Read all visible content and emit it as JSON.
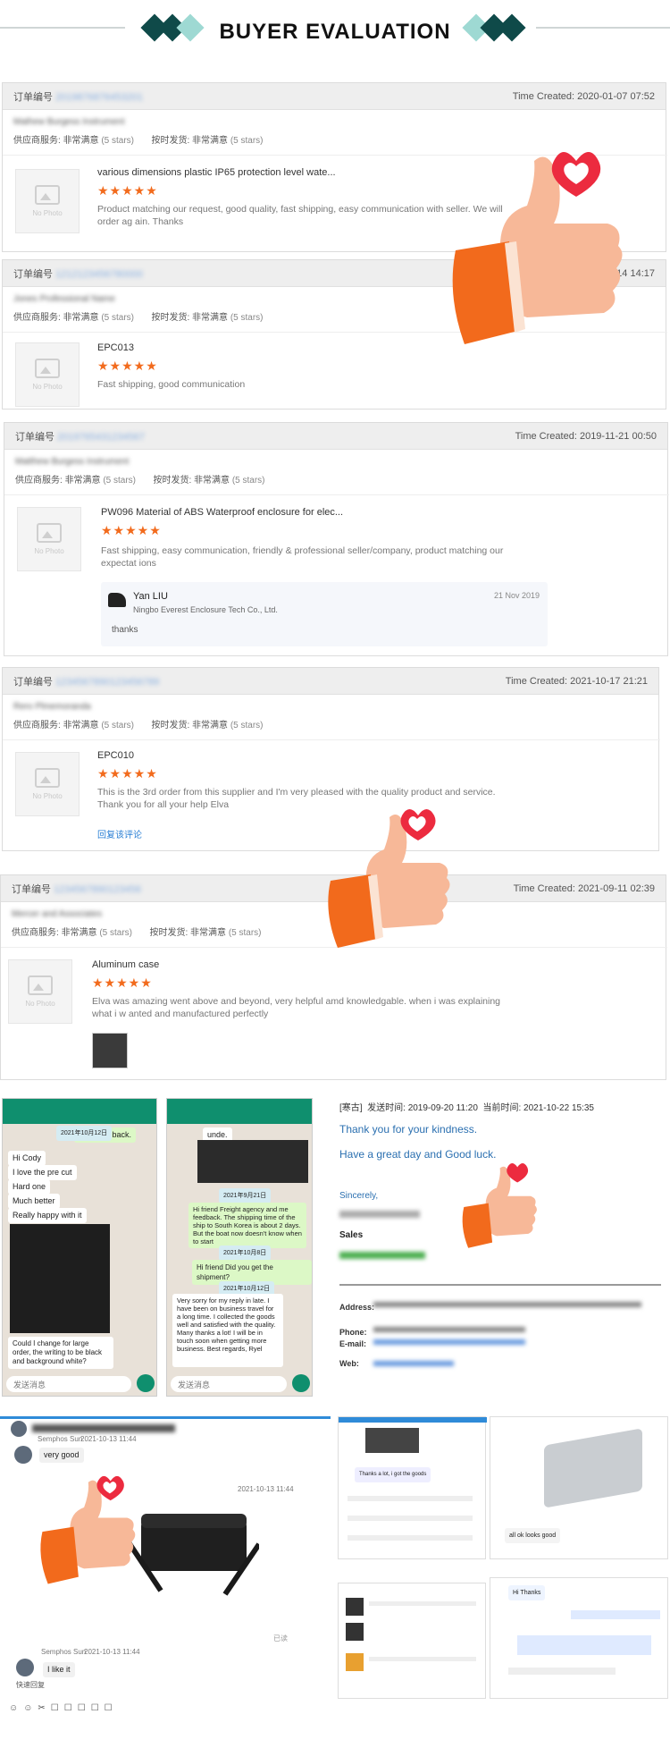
{
  "header": {
    "title": "BUYER EVALUATION",
    "accent_dark": "#0f4a49",
    "accent_light": "#9ed9d3"
  },
  "labels": {
    "order_no": "订单编号",
    "time_created": "Time Created:",
    "supplier_service": "供应商服务:",
    "on_time": "按时发货:",
    "very_satisfied": "非常满意",
    "five_stars": "(5 stars)",
    "no_photo": "No Photo",
    "stars": "★★★★★"
  },
  "reviews": [
    {
      "order": "2019876876453201",
      "buyer": "Mathew Burgess Instrument",
      "time": "2020-01-07 07:52",
      "product": "various dimensions plastic IP65 protection level wate...",
      "text": "Product matching our request, good quality, fast shipping, easy communication with seller. We will order ag ain. Thanks"
    },
    {
      "order": "1212123456780000",
      "buyer": "Jones Professional Name",
      "time": "2020-04-14 14:17",
      "product": "EPC013",
      "text": "Fast shipping, good communication"
    },
    {
      "order": "2019765431234567",
      "buyer": "Matthew Burgess Instrument",
      "time": "2019-11-21 00:50",
      "product": "PW096 Material of ABS Waterproof enclosure for elec...",
      "text": "Fast shipping, easy communication, friendly & professional seller/company, product matching our expectat ions",
      "reply": {
        "name": "Yan LIU",
        "company": "Ningbo Everest Enclosure Tech Co., Ltd.",
        "date": "21 Nov 2019",
        "text": "thanks"
      }
    },
    {
      "order": "1234567890123456789",
      "buyer": "Rero Plmemoranda",
      "time": "2021-10-17 21:21",
      "product": "EPC010",
      "text": "This is the 3rd order from this supplier and I'm very pleased with the quality product and service. Thank you for all your help Elva",
      "link": "回复该评论"
    },
    {
      "order": "1234567890123456",
      "buyer": "Mercer and Associates",
      "time": "2021-09-11 02:39",
      "product": "Aluminum case",
      "text": "Elva was amazing went above and beyond, very helpful amd knowledgable. when i was explaining what i w anted and manufactured perfectly"
    }
  ],
  "chat1": {
    "date": "2021年10月12日",
    "m1": "your feedback.",
    "lines": [
      "Hi Cody",
      "I love the pre cut",
      "Hard one",
      "Much better",
      "Really happy with it"
    ],
    "q": "Could I change for large order, the writing to be black and background white?",
    "input": "发送消息"
  },
  "chat2": {
    "top": "unde.",
    "d1": "2021年9月21日",
    "m1": "Hi friend Freight agency and me feedback. The shipping time of the ship to South Korea is about 2 days. But the boat now doesn't know when to start",
    "d2": "2021年10月8日",
    "m2": "Hi friend Did you get the shipment?",
    "d3": "2021年10月12日",
    "m3": "Very sorry for my reply in late. I have been on business travel for a long time. I collected the goods well and satisfied with the quality. Many thanks a lot! I will be in touch soon when getting more business. Best regards, Ryel",
    "input": "发送消息"
  },
  "email": {
    "from_label": "[寒古]",
    "sent": "发送时间:",
    "sent_time": "2019-09-20 11:20",
    "now": "当前时间:",
    "now_time": "2021-10-22 15:35",
    "l1": "Thank you for your kindness.",
    "l2": "Have a great day and Good luck.",
    "l3": "Sincerely,",
    "l4": "Sales",
    "addr": "Address:",
    "phone": "Phone:",
    "email": "E-mail:",
    "web": "Web:"
  },
  "qq": {
    "sender": "Semphos Sun",
    "t1": "2021-10-13 11:44",
    "m1": "very good",
    "t2": "2021-10-13 11:44",
    "t3": "2021-10-13 11:44",
    "m3": "I like it",
    "recv": "已读",
    "foot": "快速回复"
  },
  "small": {
    "s1": "Thanks a lot, i got the goods",
    "s2": "all ok looks good",
    "s3": "Hi Thanks"
  }
}
